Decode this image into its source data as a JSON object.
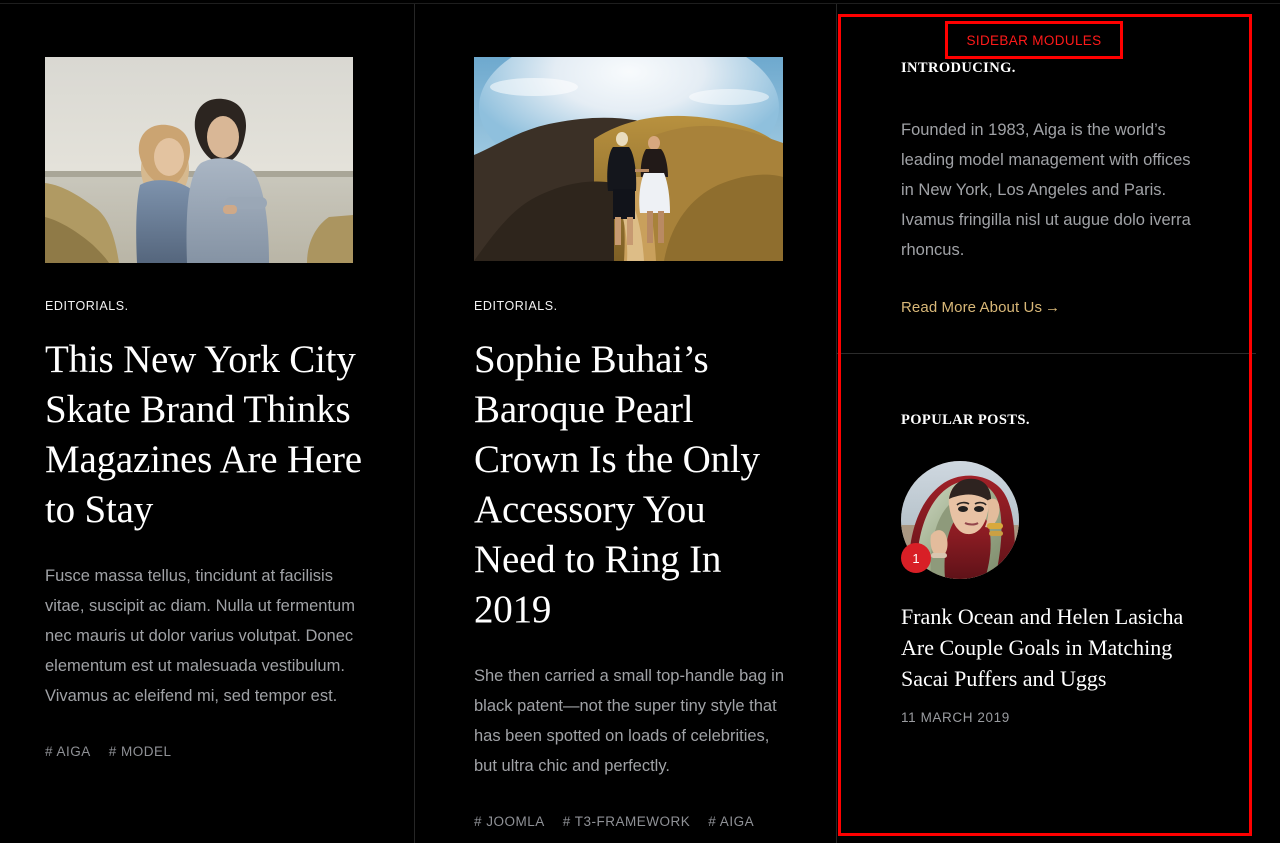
{
  "theme": {
    "background": "#000000",
    "text_primary": "#ffffff",
    "text_muted": "#a0a2a6",
    "divider": "#262626",
    "link_gold": "#d9b878",
    "annotation_red": "#ff0000",
    "badge_red": "#d81f26"
  },
  "annotation": {
    "label": "SIDEBAR MODULES"
  },
  "articles": [
    {
      "category": "EDITORIALS.",
      "title": "This New York City Skate Brand Thinks Magazines Are Here to Stay",
      "excerpt": "Fusce massa tellus, tincidunt at facilisis vitae, suscipit ac diam. Nulla ut fermentum nec mauris ut dolor varius volutpat. Donec elementum est ut malesuada vestibulum. Vivamus ac eleifend mi, sed tempor est.",
      "image_alt": "couple-leaning-by-lake-photo",
      "tags": [
        "# AIGA",
        "# MODEL"
      ]
    },
    {
      "category": "EDITORIALS.",
      "title": "Sophie Buhai’s Baroque Pearl Crown Is the Only Accessory You Need to Ring In 2019",
      "excerpt": "She then carried a small top-handle bag in black patent—not the super tiny style that has been spotted on loads of celebrities, but ultra chic and perfectly.",
      "image_alt": "couple-walking-hillside-sunset-photo",
      "tags": [
        "# JOOMLA",
        "# T3-FRAMEWORK",
        "# AIGA"
      ]
    }
  ],
  "sidebar": {
    "modules": [
      {
        "heading": "INTRODUCING.",
        "body": "Founded in 1983, Aiga is the world’s leading model management with offices in New York, Los Angeles and Paris. Ivamus fringilla nisl ut augue dolo iverra rhoncus.",
        "link_label": "Read More About Us",
        "link_arrow": "→"
      },
      {
        "heading": "POPULAR POSTS.",
        "posts": [
          {
            "rank": "1",
            "title": "Frank Ocean and Helen Lasicha Are Couple Goals in Matching Sacai Puffers and Uggs",
            "date": "11 MARCH 2019",
            "image_alt": "woman-in-red-embroidered-veil-photo"
          }
        ]
      }
    ]
  }
}
